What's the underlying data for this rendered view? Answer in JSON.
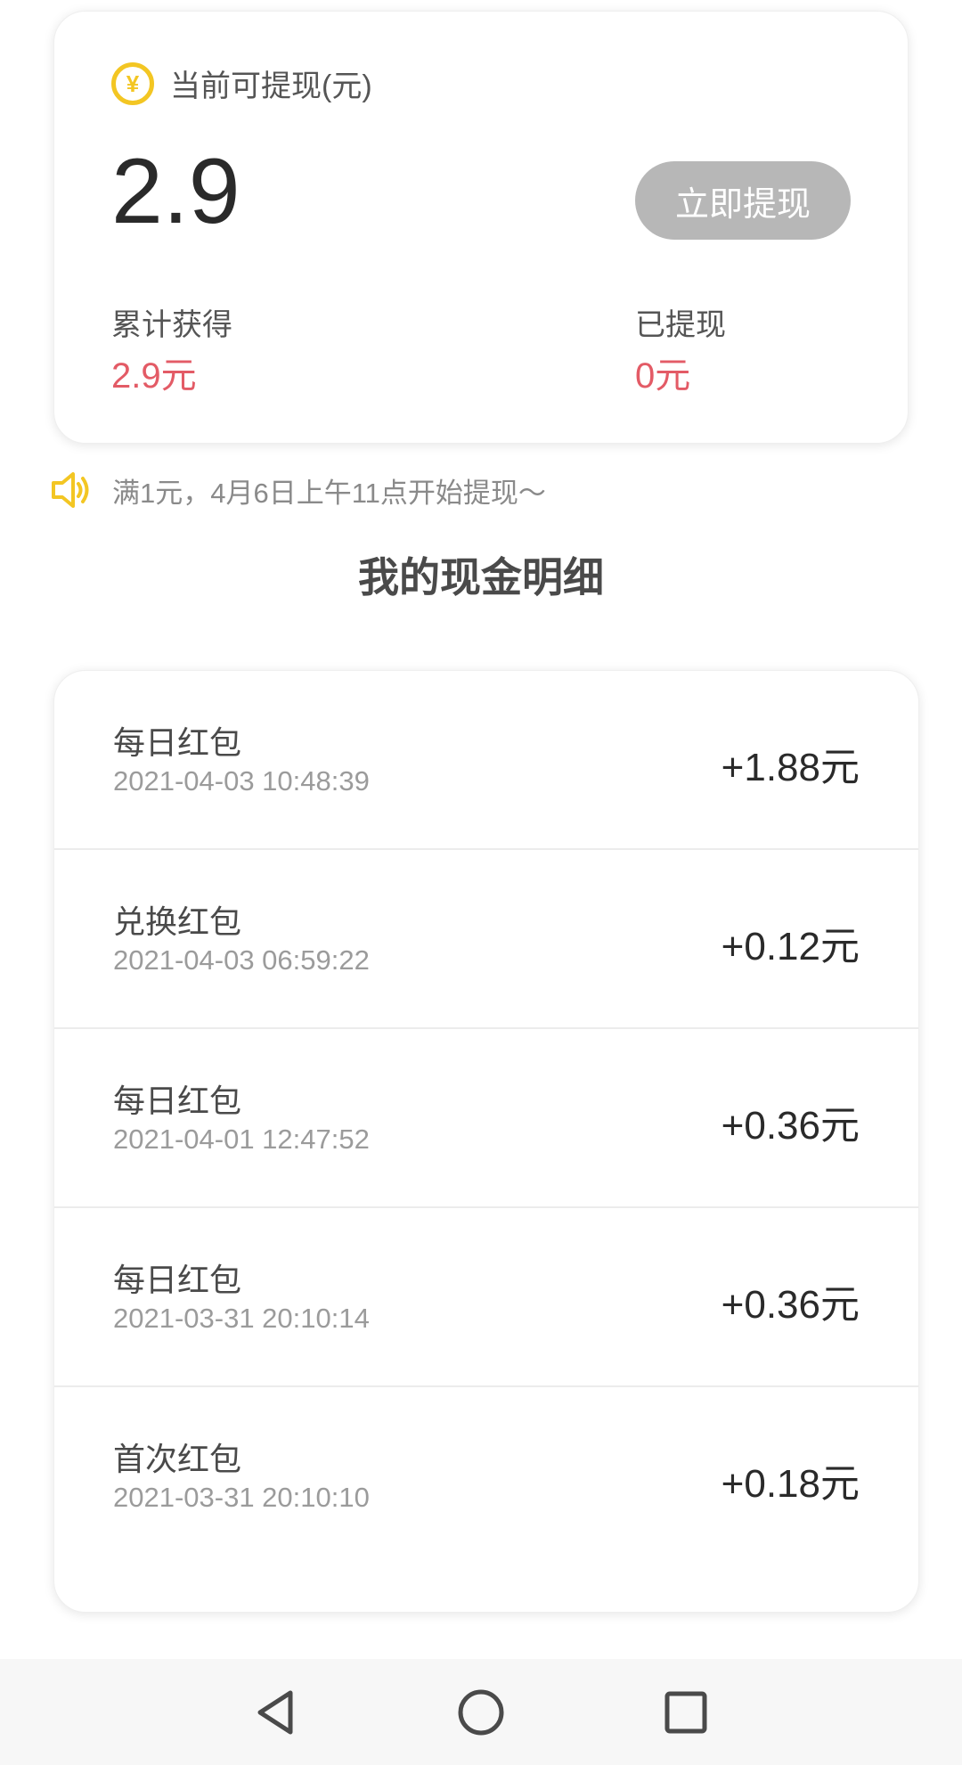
{
  "balance": {
    "icon": "yuan-coin-icon",
    "icon_glyph": "¥",
    "title": "当前可提现(元)",
    "amount": "2.9",
    "withdraw_label": "立即提现",
    "total_label": "累计获得",
    "total_value": "2.9元",
    "withdrawn_label": "已提现",
    "withdrawn_value": "0元"
  },
  "notice": {
    "icon": "speaker-icon",
    "text": "满1元，4月6日上午11点开始提现～"
  },
  "section_title": "我的现金明细",
  "records": [
    {
      "title": "每日红包",
      "time": "2021-04-03 10:48:39",
      "amount": "+1.88元"
    },
    {
      "title": "兑换红包",
      "time": "2021-04-03 06:59:22",
      "amount": "+0.12元"
    },
    {
      "title": "每日红包",
      "time": "2021-04-01 12:47:52",
      "amount": "+0.36元"
    },
    {
      "title": "每日红包",
      "time": "2021-03-31 20:10:14",
      "amount": "+0.36元"
    },
    {
      "title": "首次红包",
      "time": "2021-03-31 20:10:10",
      "amount": "+0.18元"
    }
  ],
  "nav": {
    "back_icon": "back-triangle-icon",
    "home_icon": "home-circle-icon",
    "recent_icon": "recent-square-icon"
  },
  "colors": {
    "accent_red": "#e35b66",
    "coin_yellow": "#f3c623",
    "button_gray": "#b7b7b7"
  }
}
